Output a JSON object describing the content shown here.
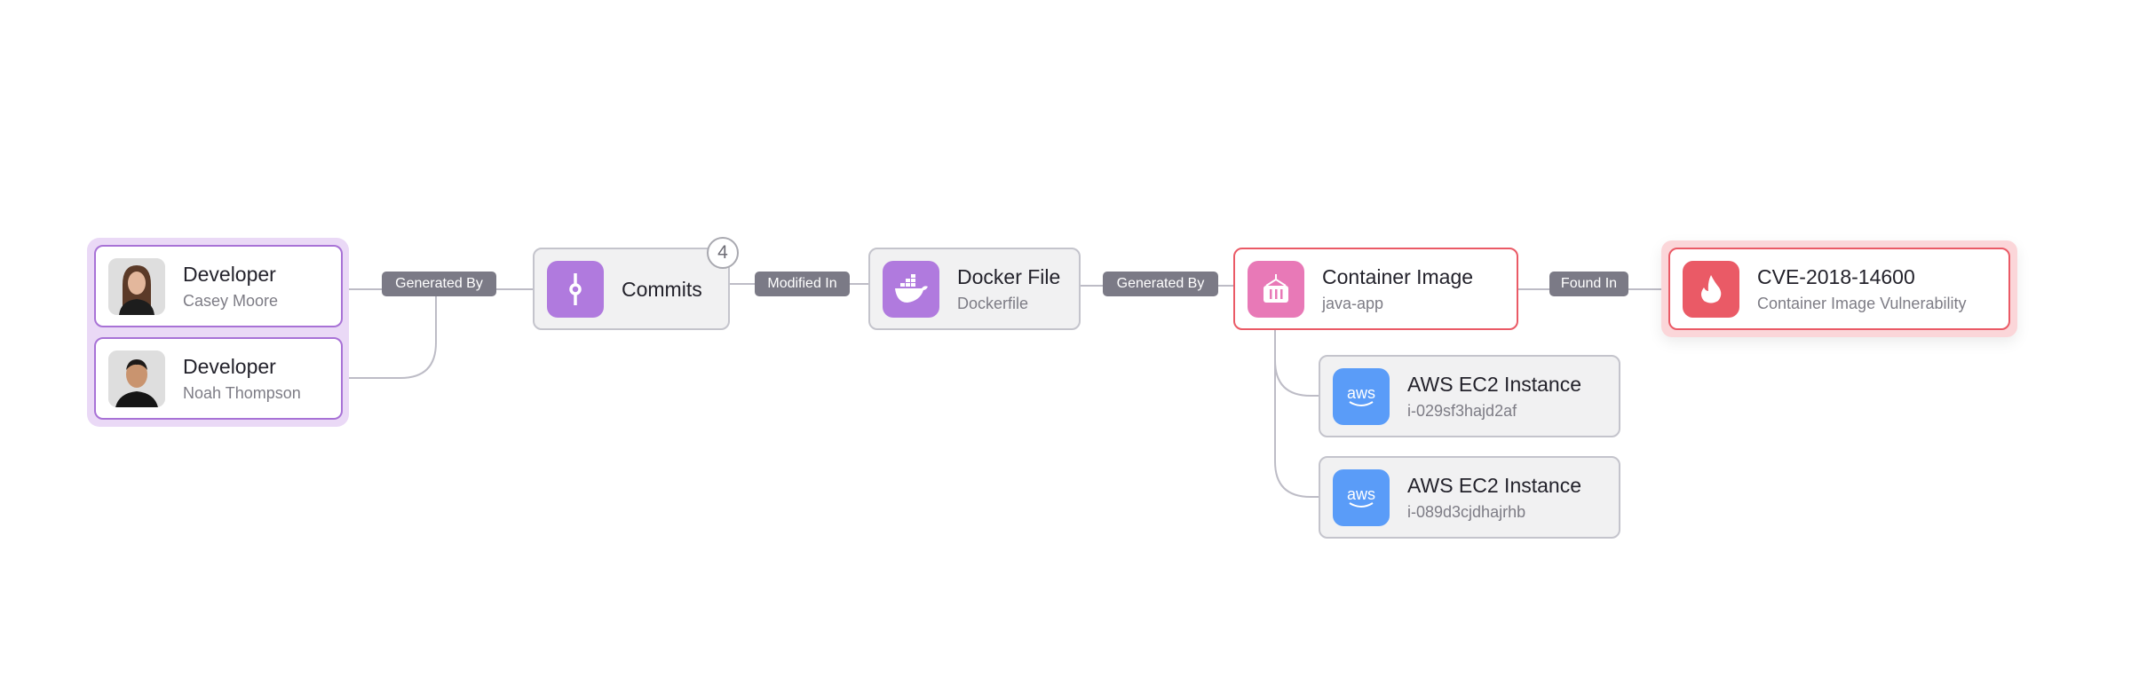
{
  "colors": {
    "developer_border": "#a872d6",
    "developer_group_bg": "#ead9f6",
    "commit_icon": "#b07ade",
    "container_icon": "#e879b7",
    "alert_red": "#ea5a66",
    "aws_icon": "#5a9cf8",
    "edge_label_bg": "#7b7a86"
  },
  "developers": [
    {
      "title": "Developer",
      "name": "Casey Moore",
      "avatar": "woman-portrait"
    },
    {
      "title": "Developer",
      "name": "Noah Thompson",
      "avatar": "man-portrait"
    }
  ],
  "edges": {
    "generated_by_1": "Generated By",
    "modified_in": "Modified In",
    "generated_by_2": "Generated By",
    "found_in": "Found In"
  },
  "commits": {
    "title": "Commits",
    "count": "4",
    "icon": "git-commit-icon"
  },
  "docker": {
    "title": "Docker File",
    "subtitle": "Dockerfile",
    "icon": "docker-icon"
  },
  "container": {
    "title": "Container Image",
    "subtitle": "java-app",
    "icon": "container-icon"
  },
  "cve": {
    "title": "CVE-2018-14600",
    "subtitle": "Container Image Vulnerability",
    "icon": "flame-icon"
  },
  "instances": [
    {
      "title": "AWS EC2 Instance",
      "id": "i-029sf3hajd2af",
      "icon": "aws-icon",
      "icon_text": "aws"
    },
    {
      "title": "AWS EC2 Instance",
      "id": "i-089d3cjdhajrhb",
      "icon": "aws-icon",
      "icon_text": "aws"
    }
  ]
}
